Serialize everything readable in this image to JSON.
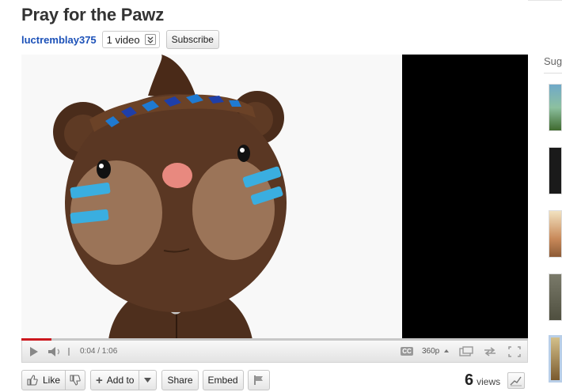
{
  "video": {
    "title": "Pray for the Pawz",
    "channel": "luctremblay375",
    "video_count": "1 video",
    "subscribe_label": "Subscribe"
  },
  "player": {
    "current_time": "0:04",
    "duration": "1:06",
    "time_display": "0:04 / 1:06",
    "quality": "360p",
    "cc_label": "CC",
    "progress_fraction": 0.06
  },
  "actions": {
    "like_label": "Like",
    "add_to_label": "Add to",
    "share_label": "Share",
    "embed_label": "Embed"
  },
  "stats": {
    "views_count": "6",
    "views_label": "views"
  },
  "suggestions": {
    "header": "Sug"
  }
}
